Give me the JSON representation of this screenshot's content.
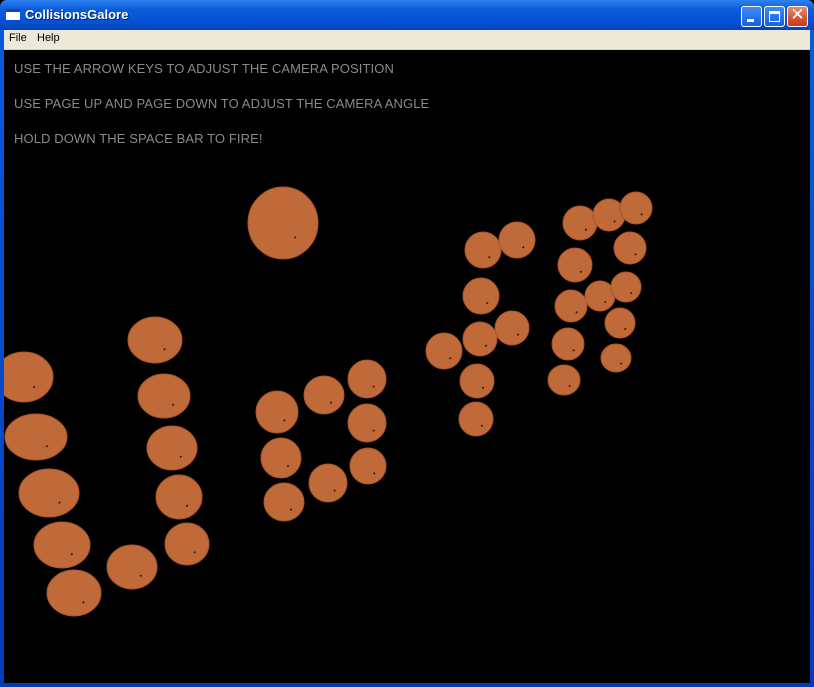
{
  "window": {
    "title": "CollisionsGalore",
    "menu": [
      "File",
      "Help"
    ]
  },
  "instructions": [
    "USE THE ARROW KEYS TO ADJUST THE CAMERA POSITION",
    "USE PAGE UP AND PAGE DOWN TO ADJUST THE CAMERA ANGLE",
    "HOLD DOWN THE SPACE BAR TO FIRE!"
  ],
  "colors": {
    "ball": "#c06a3a",
    "ball_edge": "#a9552a",
    "background": "#000000",
    "instruction_text": "#8a8a8a"
  }
}
